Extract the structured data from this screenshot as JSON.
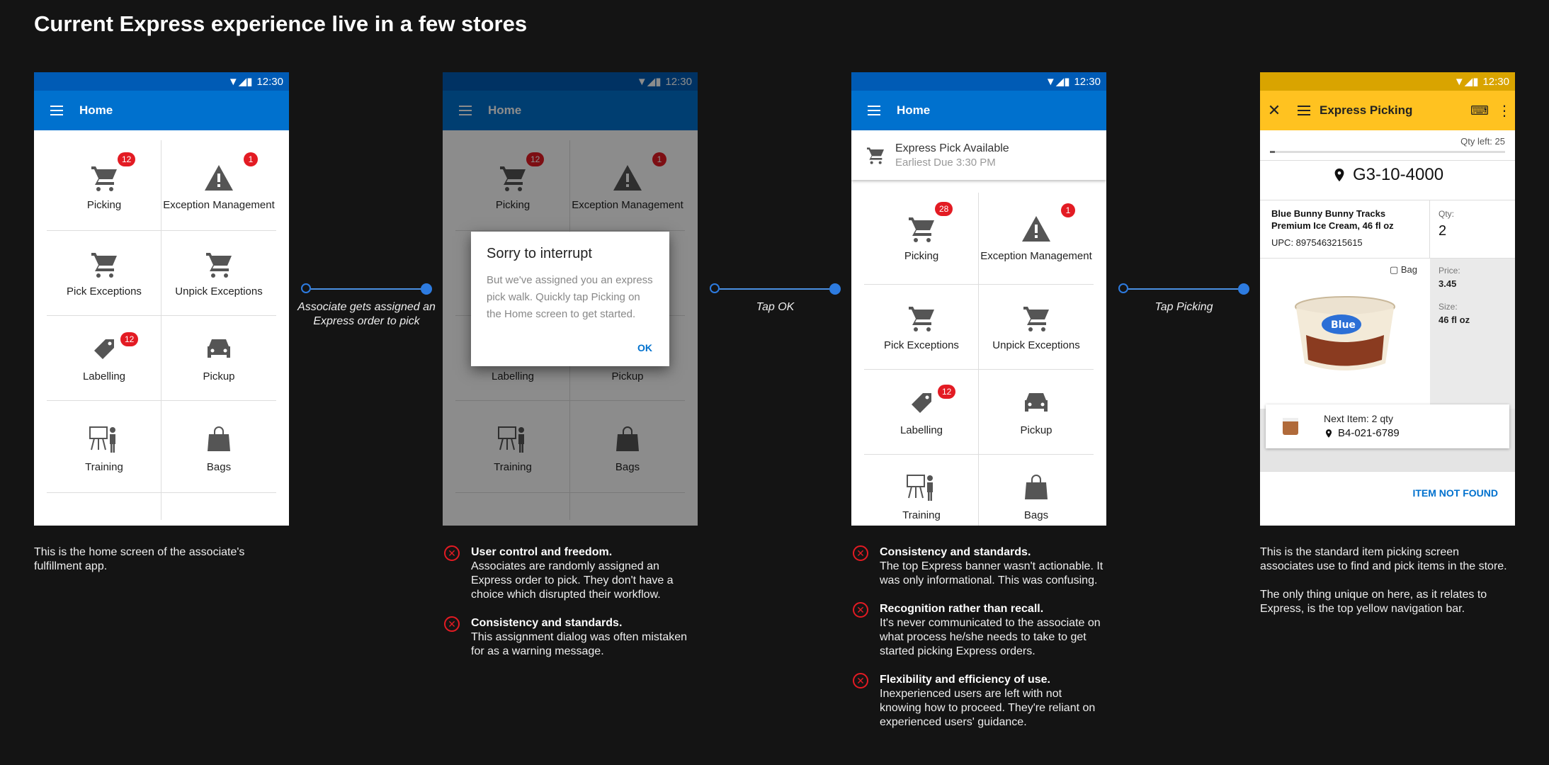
{
  "page_title": "Current Express experience live in a few stores",
  "status_time": "12:30",
  "home_title": "Home",
  "tiles": {
    "picking": "Picking",
    "exception": "Exception Management",
    "pick_exceptions": "Pick Exceptions",
    "unpick_exceptions": "Unpick Exceptions",
    "labelling": "Labelling",
    "pickup": "Pickup",
    "training": "Training",
    "bags": "Bags"
  },
  "badges": {
    "picking_home": "12",
    "picking_express": "28",
    "exception": "1",
    "labelling": "12"
  },
  "dialog": {
    "title": "Sorry to interrupt",
    "body": "But we've assigned you an express pick walk. Quickly tap Picking on the Home screen to get started.",
    "ok": "OK"
  },
  "express_banner": {
    "title": "Express Pick Available",
    "subtitle": "Earliest Due 3:30 PM"
  },
  "picking_screen": {
    "title": "Express Picking",
    "qty_left": "Qty left: 25",
    "location": "G3-10-4000",
    "product_name": "Blue Bunny Bunny Tracks Premium Ice Cream, 46 fl oz",
    "upc": "UPC: 8975463215615",
    "qty_label": "Qty:",
    "qty_value": "2",
    "bag_label": "Bag",
    "price_label": "Price:",
    "price_value": "3.45",
    "size_label": "Size:",
    "size_value": "46 fl oz",
    "next_item": "Next Item: 2 qty",
    "next_location": "B4-021-6789",
    "item_not_found": "ITEM NOT FOUND"
  },
  "connectors": {
    "c1": "Associate gets assigned an  Express order to pick",
    "c2": "Tap OK",
    "c3": "Tap Picking"
  },
  "captions": {
    "home": "This is the home screen of the associate's fulfillment app.",
    "dialog_issues": [
      {
        "title": "User control and freedom.",
        "body": "Associates are randomly assigned an Express order to pick. They don't have a choice which disrupted their workflow."
      },
      {
        "title": "Consistency and standards.",
        "body": "This assignment dialog was often mistaken for as a warning message."
      }
    ],
    "express_issues": [
      {
        "title": "Consistency and standards.",
        "body": "The top Express banner wasn't actionable. It was only informational. This was confusing."
      },
      {
        "title": "Recognition rather than recall.",
        "body": "It's never communicated to the associate on what process he/she needs to take to get started picking Express orders."
      },
      {
        "title": "Flexibility and efficiency of use.",
        "body": "Inexperienced users are left with not knowing how to proceed. They're reliant on experienced users' guidance."
      }
    ],
    "picking_p1": "This is the standard item picking screen associates use to find and pick items in the store.",
    "picking_p2": "The only thing unique on here, as it relates to Express, is the top yellow navigation bar."
  },
  "colors": {
    "primary_blue": "#0071ce",
    "express_yellow": "#ffc220",
    "badge_red": "#e31b23",
    "connector_blue": "#2d7be0"
  }
}
